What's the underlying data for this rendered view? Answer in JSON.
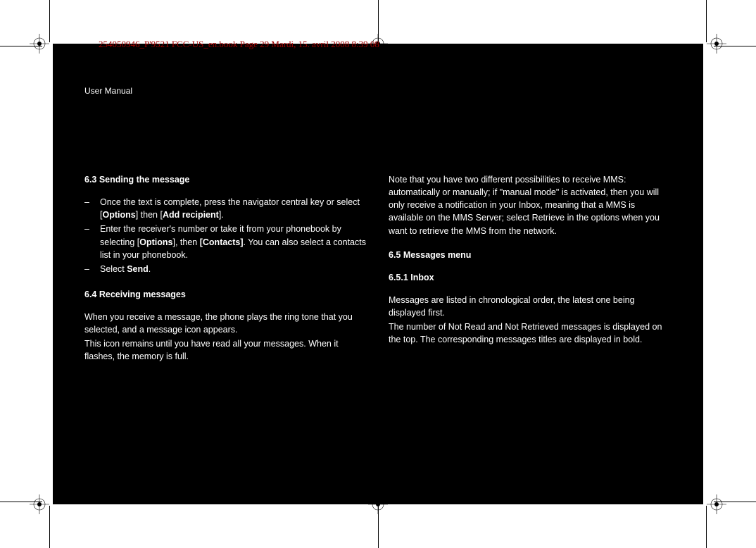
{
  "meta": {
    "header_note": "254050946_P'9521 FCC-US_en.book  Page 29  Mardi, 15. avril 2008  8:39 08"
  },
  "doc": {
    "title": "User Manual"
  },
  "left": {
    "h63": "6.3 Sending the message",
    "b1a": "Once the text is complete, press the navigator central key or select [",
    "b1b": "Options",
    "b1c": "] then [",
    "b1d": "Add recipient",
    "b1e": "].",
    "b2a": "Enter the receiver's number or take it from your phonebook by selecting [",
    "b2b": "Options",
    "b2c": "], then ",
    "b2d": "[Contacts]",
    "b2e": ". You can also select a contacts list in your phonebook.",
    "b3a": "Select ",
    "b3b": "Send",
    "b3c": ".",
    "h64": "6.4 Receiving messages",
    "p64a": "When you receive a message, the phone plays the ring tone that you selected, and a message icon appears.",
    "p64b": "This icon remains until you have read all your messages. When it flashes, the memory is full."
  },
  "right": {
    "note": "Note that you have two different possibilities to receive MMS: automatically or manually; if \"manual mode\" is activated, then you will only receive a notification in your Inbox, meaning that a MMS is available on the MMS Server; select Retrieve in the options when you want to retrieve the MMS from the network.",
    "h65": "6.5 Messages menu",
    "h651": "6.5.1 Inbox",
    "p651a": "Messages are listed in chronological order, the latest one being displayed first.",
    "p651b": "The number of Not Read and Not Retrieved messages is displayed on the top. The corresponding messages titles are displayed in bold."
  }
}
